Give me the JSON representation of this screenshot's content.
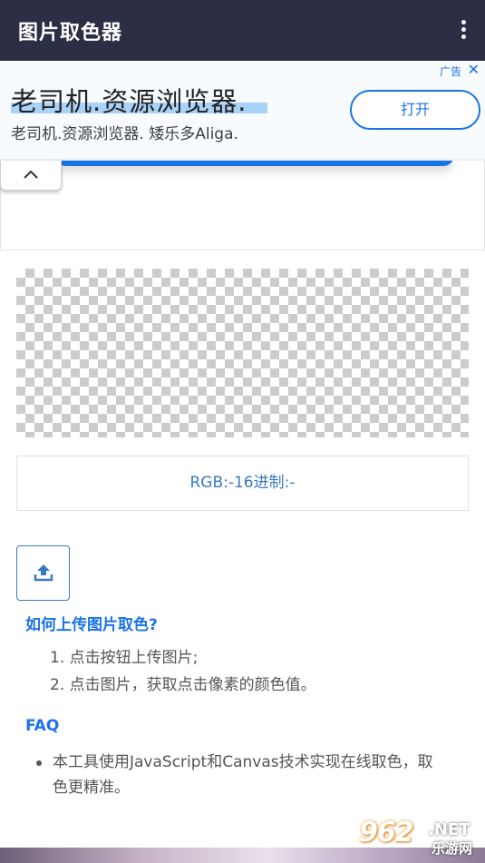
{
  "app": {
    "title": "图片取色器"
  },
  "ad": {
    "label": "广告",
    "close": "✕",
    "headline": "老司机.资源浏览器.",
    "subtext": "老司机.资源浏览器. 矮乐多Aliga.",
    "cta": "打开"
  },
  "picker": {
    "rgb_text": "RGB:-16进制:-"
  },
  "help": {
    "how_title": "如何上传图片取色?",
    "steps": [
      "1.  点击按钮上传图片;",
      "2.  点击图片，获取点击像素的颜色值。"
    ],
    "faq_title": "FAQ",
    "faq_items": [
      "本工具使用JavaScript和Canvas技术实现在线取色，取色更精准。"
    ]
  },
  "watermark": {
    "main": "962",
    "net": ".NET",
    "sub": "乐游网"
  },
  "colors": {
    "appbar": "#2b2e44",
    "accent": "#1a73e8",
    "rgb_text": "#3a78c3"
  },
  "icons": {
    "menu": "more-vert-icon",
    "collapse": "chevron-up-icon",
    "upload": "upload-icon"
  }
}
